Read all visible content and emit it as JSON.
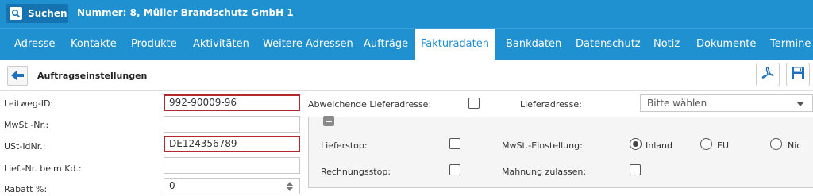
{
  "topbar": {
    "search_label": "Suchen",
    "record_title": "Nummer: 8, Müller Brandschutz GmbH 1"
  },
  "tabs": [
    {
      "label": "Adresse"
    },
    {
      "label": "Kontakte"
    },
    {
      "label": "Produkte"
    },
    {
      "label": "Aktivitäten"
    },
    {
      "label": "Weitere Adressen"
    },
    {
      "label": "Aufträge"
    },
    {
      "label": "Fakturadaten",
      "active": true
    },
    {
      "label": "Bankdaten"
    },
    {
      "label": "Datenschutz"
    },
    {
      "label": "Notiz"
    },
    {
      "label": "Dokumente"
    },
    {
      "label": "Termine"
    }
  ],
  "subheader": {
    "title": "Auftragseinstellungen"
  },
  "form": {
    "leitweg_label": "Leitweg-ID:",
    "leitweg_value": "992-90009-96",
    "mwst_label": "MwSt.-Nr.:",
    "mwst_value": "",
    "ust_label": "USt-IdNr.:",
    "ust_value": "DE124356789",
    "lief_label": "Lief.-Nr. beim Kd.:",
    "lief_value": "",
    "rabatt_label": "Rabatt %:",
    "rabatt_value": "0"
  },
  "delivery": {
    "abweichend_label": "Abweichende Lieferadresse:",
    "abweichend_checked": false,
    "lieferadresse_label": "Lieferadresse:",
    "lieferadresse_value": "Bitte wählen"
  },
  "options": {
    "lieferstop_label": "Lieferstop:",
    "rechnungsstop_label": "Rechnungsstop:",
    "mwst_einstellung_label": "MwSt.-Einstellung:",
    "mahnung_label": "Mahnung zulassen:",
    "radio_inland": "Inland",
    "radio_eu": "EU",
    "radio_nic": "Nic",
    "selected_radio": "Inland"
  },
  "colors": {
    "brand": "#1f90d0",
    "error_border": "#b4272d"
  },
  "icons": {
    "search": "search-icon",
    "back": "arrow-left-icon",
    "pdf": "pdf-icon",
    "save": "floppy-disk-icon",
    "collapse": "minus-icon",
    "dropdown": "chevron-down-icon"
  }
}
